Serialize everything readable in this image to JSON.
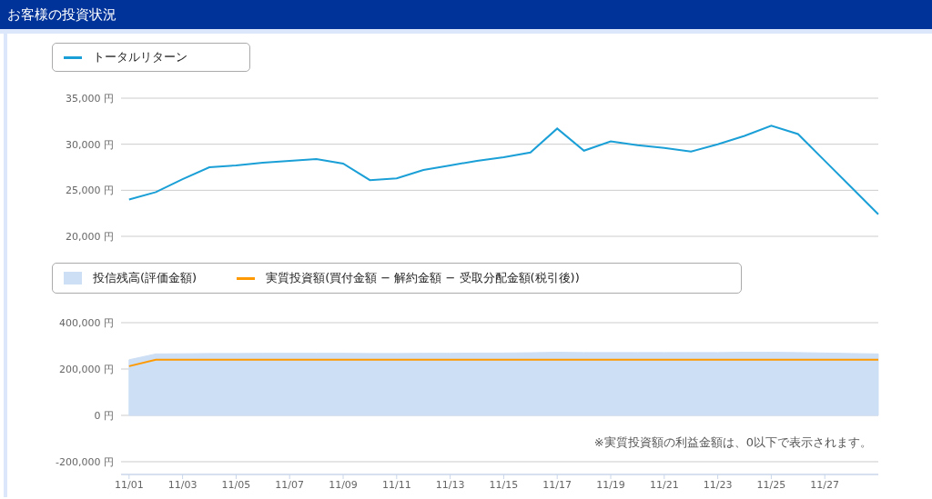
{
  "header": {
    "title": "お客様の投資状況"
  },
  "charts": [
    {
      "chart_data": {
        "type": "line",
        "grid": true,
        "categories": [
          null,
          null,
          null,
          null,
          null,
          null,
          null,
          null,
          null,
          null,
          null,
          null,
          null,
          null,
          null,
          null,
          null,
          null,
          null,
          null,
          null,
          null,
          null,
          null,
          null,
          null,
          null,
          null,
          null
        ],
        "series": [
          {
            "name": "トータルリターン",
            "color": "#1a9fd6",
            "values": [
              24000,
              24800,
              26200,
              27500,
              27700,
              28000,
              28200,
              28400,
              27900,
              26100,
              26300,
              27200,
              27700,
              28200,
              28600,
              29100,
              31700,
              29300,
              30300,
              29900,
              29600,
              29200,
              30000,
              30900,
              32000,
              31100,
              28200,
              25300,
              22400
            ]
          }
        ],
        "ylim": [
          20000,
          35000
        ],
        "yticks": [
          {
            "value": 35000,
            "label": "35,000 円"
          },
          {
            "value": 30000,
            "label": "30,000 円"
          },
          {
            "value": 25000,
            "label": "25,000 円"
          },
          {
            "value": 20000,
            "label": "20,000 円"
          }
        ]
      }
    },
    {
      "note": "※実質投資額の利益金額は、0以下で表示されます。",
      "chart_data": {
        "type": "area",
        "grid": true,
        "categories": [
          "11/01",
          null,
          "11/03",
          null,
          "11/05",
          null,
          "11/07",
          null,
          "11/09",
          null,
          "11/11",
          null,
          "11/13",
          null,
          "11/15",
          null,
          "11/17",
          null,
          "11/19",
          null,
          "11/21",
          null,
          "11/23",
          null,
          "11/25",
          null,
          "11/27",
          null,
          null
        ],
        "series": [
          {
            "name": "投信残高(評価金額)",
            "color": "#cddff5",
            "values": [
              240000,
              265000,
              266000,
              267000,
              267000,
              268000,
              268000,
              268000,
              268000,
              267000,
              267000,
              268000,
              268000,
              269000,
              269000,
              270000,
              272000,
              271000,
              271000,
              271000,
              271000,
              271000,
              271000,
              272000,
              272000,
              271000,
              269000,
              267000,
              265000
            ]
          },
          {
            "name": "実質投資額(買付金額 − 解約金額 − 受取分配金額(税引後))",
            "color": "#ff9900",
            "type": "line",
            "values": [
              212000,
              240000,
              240000,
              240000,
              240000,
              240000,
              240000,
              240000,
              240000,
              240000,
              240000,
              240000,
              240000,
              240000,
              240000,
              240000,
              240000,
              240000,
              240000,
              240000,
              240000,
              240000,
              240000,
              240000,
              240000,
              240000,
              240000,
              240000,
              240000
            ]
          }
        ],
        "ylim": [
          -255000,
          400000
        ],
        "yticks": [
          {
            "value": 400000,
            "label": "400,000 円"
          },
          {
            "value": 200000,
            "label": "200,000 円"
          },
          {
            "value": 0,
            "label": "0 円"
          },
          {
            "value": -200000,
            "label": "-200,000 円"
          }
        ]
      }
    }
  ]
}
